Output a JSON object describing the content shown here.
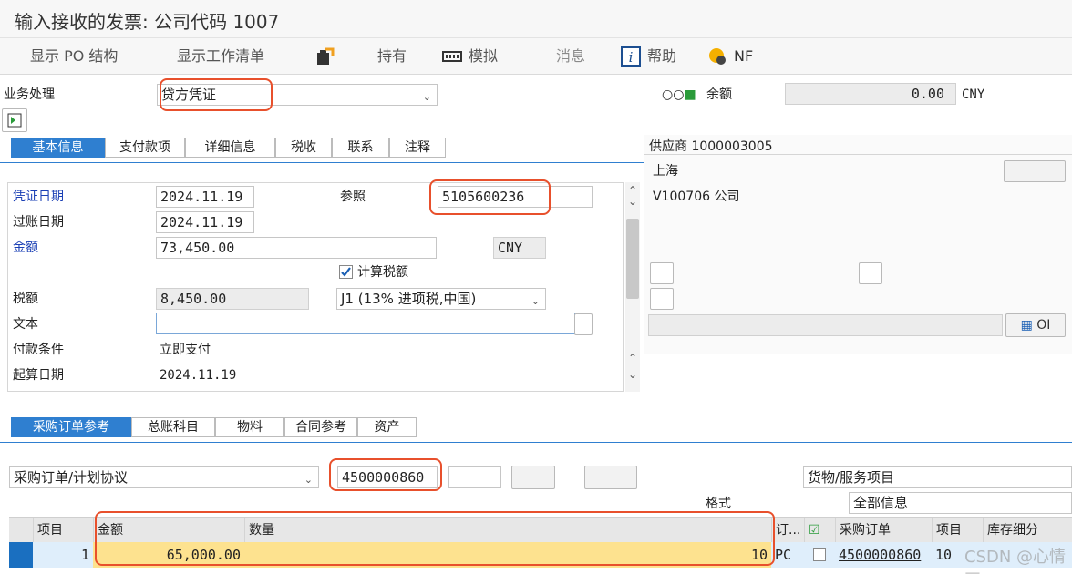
{
  "window": {
    "title": "输入接收的发票: 公司代码 1007"
  },
  "toolbar": {
    "show_po_structure": "显示 PO 结构",
    "show_worklist": "显示工作清单",
    "hold": "持有",
    "simulate": "模拟",
    "messages": "消息",
    "help": "帮助",
    "nf": "NF"
  },
  "header": {
    "transaction_label": "业务处理",
    "transaction_value": "贷方凭证",
    "balance_label": "余额",
    "balance_value": "0.00",
    "balance_currency": "CNY"
  },
  "tabs": [
    "基本信息",
    "支付款项",
    "详细信息",
    "税收",
    "联系",
    "注释"
  ],
  "basic": {
    "doc_date_label": "凭证日期",
    "doc_date": "2024.11.19",
    "reference_label": "参照",
    "reference": "5105600236",
    "posting_date_label": "过账日期",
    "posting_date": "2024.11.19",
    "amount_label": "金额",
    "amount": "73,450.00",
    "amount_currency": "CNY",
    "calc_tax_label": "计算税额",
    "calc_tax_checked": true,
    "tax_amount_label": "税额",
    "tax_amount": "8,450.00",
    "tax_code": "J1 (13% 进项税,中国)",
    "text_label": "文本",
    "text_value": "",
    "payment_terms_label": "付款条件",
    "payment_terms": "立即支付",
    "baseline_date_label": "起算日期",
    "baseline_date": "2024.11.19"
  },
  "vendor": {
    "title": "供应商 1000003005",
    "city": "上海",
    "name": "V100706 公司",
    "oi_label": "OI"
  },
  "po_tabs": [
    "采购订单参考",
    "总账科目",
    "物料",
    "合同参考",
    "资产"
  ],
  "po": {
    "ref_type": "采购订单/计划协议",
    "po_number": "4500000860",
    "item_type": "货物/服务项目",
    "layout_label": "格式",
    "layout_value": "全部信息"
  },
  "table": {
    "columns": [
      "项目",
      "金额",
      "数量",
      "订...",
      "",
      "采购订单",
      "项目",
      "库存细分"
    ],
    "rows": [
      {
        "item": "1",
        "amount": "65,000.00",
        "quantity": "10",
        "unit": "PC",
        "po": "4500000860",
        "po_item": "10"
      }
    ]
  },
  "watermark": "CSDN @心情豆",
  "colors": {
    "accent": "#2f7fd0",
    "highlight": "#e8502c",
    "row_yellow": "#fde28f"
  }
}
